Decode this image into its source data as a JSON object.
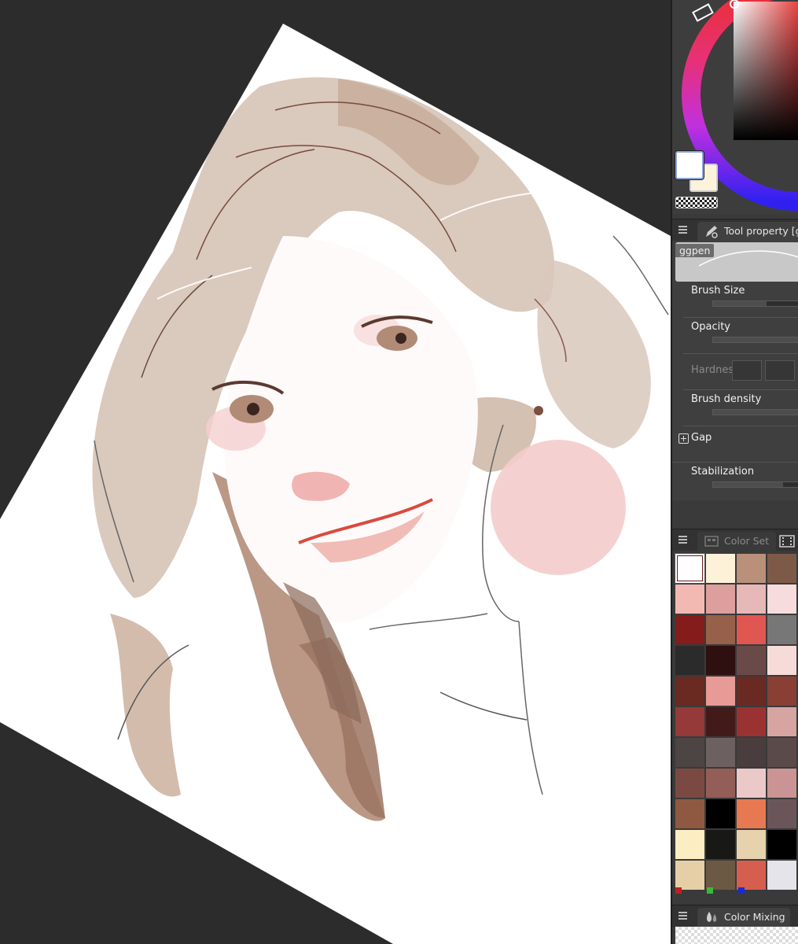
{
  "tool_property": {
    "tab_label": "Tool property [gg",
    "tab_icon": "pen-tool-icon",
    "brush_name": "ggpen",
    "brush_size": {
      "label": "Brush Size",
      "level": 0.62
    },
    "opacity": {
      "label": "Opacity",
      "level": 1.0
    },
    "hardness": {
      "label": "Hardness"
    },
    "brush_density": {
      "label": "Brush density",
      "level": 1.0
    },
    "gap": {
      "label": "Gap"
    },
    "stabilization": {
      "label": "Stabilization",
      "level": 0.82
    }
  },
  "color_set": {
    "tab_label": "Color Set",
    "tab_icon": "color-set-icon",
    "swatches": [
      "#ffffff",
      "#fdf2d8",
      "#b99079",
      "#7d5a48",
      "#f2b9b3",
      "#dd9f9d",
      "#e6b8b8",
      "#f6dcdc",
      "#841c1c",
      "#97604a",
      "#e05752",
      "#777777",
      "#2b2b2b",
      "#2e1010",
      "#6a4a48",
      "#f6dcd9",
      "#6a2a22",
      "#e89a96",
      "#6a2a22",
      "#8a3f35",
      "#953939",
      "#421a1a",
      "#9b3232",
      "#d6a5a2",
      "#4d4444",
      "#6d6060",
      "#4a3d3d",
      "#5a4a4a",
      "#7a4a42",
      "#945e58",
      "#ecc9c9",
      "#c99493",
      "#8f5941",
      "#000000",
      "#e67952",
      "#6a5658",
      "#fdedc3",
      "#181814",
      "#e6d2ad",
      "#000000",
      "#e6cfa6",
      "#6b5944",
      "#d65e4f",
      "#e4e4ea"
    ],
    "dot_colors": [
      "#c02020",
      "#3ab83a",
      "#1a2ad8"
    ]
  },
  "color_mixing": {
    "tab_label": "Color Mixing",
    "tab_icon": "color-mixing-icon"
  },
  "colors": {
    "main_color": "#ffffff",
    "sub_color": "#fdf3dc",
    "canvas_bg": "#2c2c2c",
    "panel_bg": "#3a3a3a"
  }
}
